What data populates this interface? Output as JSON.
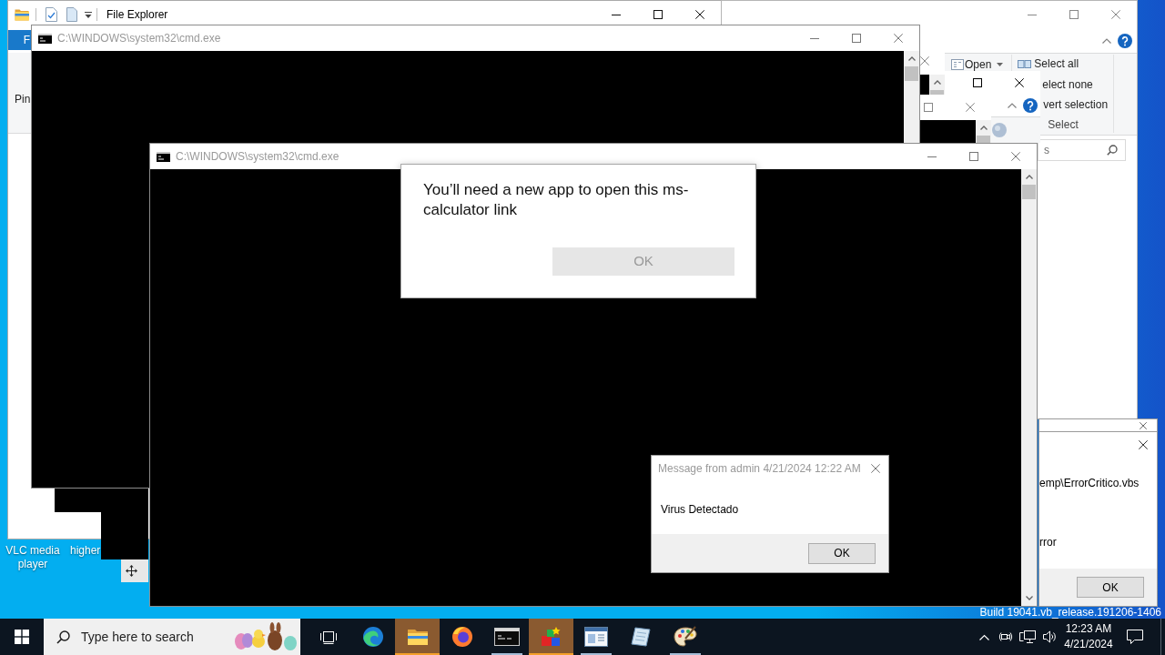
{
  "desktop": {
    "icons": [
      {
        "label": "VLC media player"
      },
      {
        "label": "higher"
      }
    ],
    "build_text": "Build 19041.vb_release.191206-1406"
  },
  "windows": [
    {
      "kind": "explorer",
      "title": "File Explorer",
      "active": true,
      "tab": "F",
      "ribbon_text": "Pin"
    },
    {
      "kind": "explorer_ribbon",
      "active": false,
      "open_label": "Open",
      "select_items": [
        "Select all",
        "elect none",
        "vert selection"
      ],
      "group_label": "Select",
      "search": {
        "placeholder": "s"
      }
    },
    {
      "kind": "dialog_edge"
    },
    {
      "kind": "error_dialog",
      "lines": [
        "emp\\ErrorCritico.vbs",
        "rror"
      ],
      "button": "OK"
    },
    {
      "kind": "explorer_fragment",
      "active": true
    },
    {
      "kind": "console_fragment",
      "active": false
    },
    {
      "kind": "console_fragment",
      "active": false
    },
    {
      "kind": "console",
      "title": "C:\\WINDOWS\\system32\\cmd.exe",
      "active": false
    },
    {
      "kind": "console",
      "title": "C:\\WINDOWS\\system32\\cmd.exe",
      "active": false
    },
    {
      "kind": "app_dialog",
      "message": "You’ll need a new app to open this ms-calculator link",
      "button": "OK"
    },
    {
      "kind": "message_box",
      "title": "Message from admin 4/21/2024 12:22 AM",
      "active": false,
      "message": "Virus Detectado",
      "button": "OK"
    }
  ],
  "taskbar": {
    "search": {
      "placeholder": "Type here to search"
    },
    "apps": [
      {
        "kind": "swirl",
        "running": false,
        "flashing": false
      },
      {
        "kind": "folder",
        "running": true,
        "flashing": true
      },
      {
        "kind": "globe",
        "running": false,
        "flashing": false
      },
      {
        "kind": "terminal",
        "running": true,
        "flashing": false
      },
      {
        "kind": "cubes",
        "running": true,
        "flashing": true
      },
      {
        "kind": "form",
        "running": true,
        "flashing": false
      },
      {
        "kind": "notepad",
        "running": false,
        "flashing": false
      },
      {
        "kind": "palette",
        "running": true,
        "flashing": false
      }
    ],
    "clock": {
      "time": "12:23 AM",
      "date": "4/21/2024"
    }
  }
}
